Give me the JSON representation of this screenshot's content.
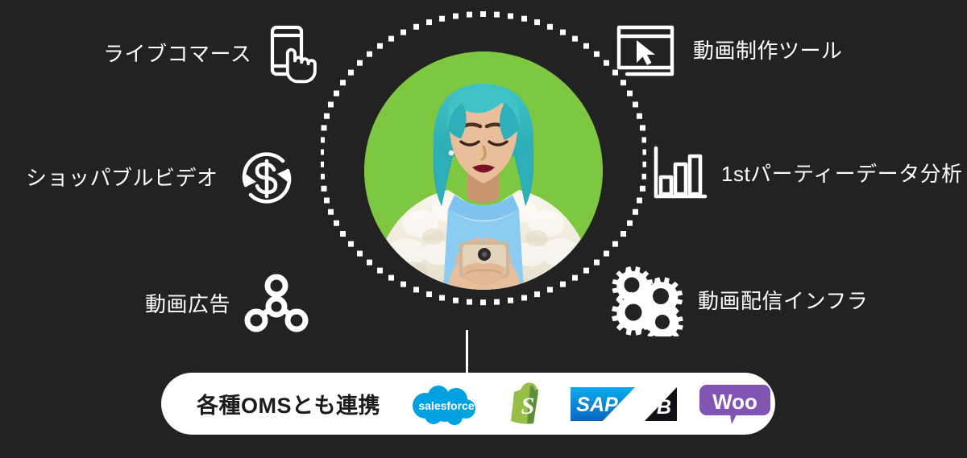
{
  "page": {
    "background_color": "#222222",
    "accent_color": "#ffffff"
  },
  "hub": {
    "name": "center-photo",
    "description": "circular photo of woman with teal hair using a smartphone",
    "photo_background_color": "#7CC63F",
    "ring_style": "dotted"
  },
  "features": [
    {
      "id": "live-commerce",
      "label": "ライブコマース",
      "icon": "phone-tap-icon",
      "side": "left"
    },
    {
      "id": "shoppable-video",
      "label": "ショッパブルビデオ",
      "icon": "dollar-cycle-icon",
      "side": "left"
    },
    {
      "id": "video-ads",
      "label": "動画広告",
      "icon": "network-share-icon",
      "side": "left"
    },
    {
      "id": "video-creation-tool",
      "label": "動画制作ツール",
      "icon": "window-cursor-icon",
      "side": "right"
    },
    {
      "id": "first-party-data",
      "label": "1stパーティーデータ分析",
      "icon": "bar-chart-icon",
      "side": "right"
    },
    {
      "id": "video-delivery-infra",
      "label": "動画配信インフラ",
      "icon": "gears-icon",
      "side": "right"
    }
  ],
  "oms": {
    "title": "各種OMSとも連携",
    "logos": [
      {
        "name": "salesforce",
        "text": "salesforce",
        "color": "#00A1E0"
      },
      {
        "name": "shopify",
        "text": "S",
        "color": "#95BF47"
      },
      {
        "name": "sap",
        "text": "SAP",
        "color": "#008FD3"
      },
      {
        "name": "bigcommerce",
        "text": "B",
        "color": "#121118"
      },
      {
        "name": "woocommerce",
        "text": "Woo",
        "color": "#7F54B3"
      }
    ]
  }
}
